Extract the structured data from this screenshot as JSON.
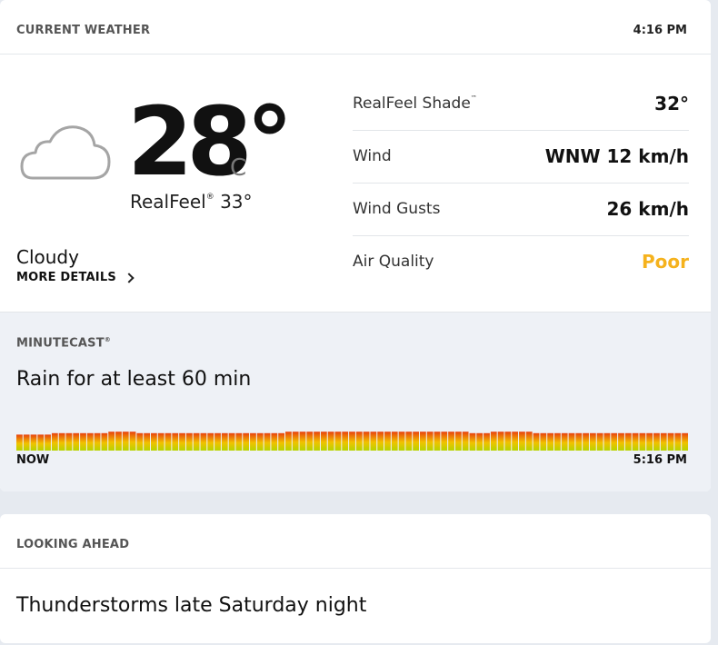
{
  "current_weather": {
    "title": "CURRENT WEATHER",
    "time": "4:16 PM",
    "icon": "cloud-icon",
    "temperature": "28°",
    "unit": "C",
    "realfeel_label": "RealFeel",
    "realfeel_value": "33°",
    "condition": "Cloudy",
    "more_details": "MORE DETAILS",
    "details": [
      {
        "label": "RealFeel Shade",
        "mark": "™",
        "value": "32°",
        "color": "#111111"
      },
      {
        "label": "Wind",
        "mark": "",
        "value": "WNW 12 km/h",
        "color": "#111111"
      },
      {
        "label": "Wind Gusts",
        "mark": "",
        "value": "26 km/h",
        "color": "#111111"
      },
      {
        "label": "Air Quality",
        "mark": "",
        "value": "Poor",
        "color": "#f5b21d"
      }
    ]
  },
  "minutecast": {
    "title": "MINUTECAST",
    "summary": "Rain for at least 60 min",
    "start_label": "NOW",
    "end_label": "5:16 PM",
    "intensities": [
      1,
      1,
      1,
      1,
      1,
      2,
      2,
      2,
      2,
      2,
      2,
      2,
      2,
      3,
      3,
      3,
      3,
      2,
      2,
      2,
      2,
      2,
      2,
      2,
      2,
      2,
      2,
      2,
      2,
      2,
      2,
      2,
      2,
      2,
      2,
      2,
      2,
      2,
      3,
      3,
      3,
      3,
      3,
      3,
      3,
      3,
      3,
      3,
      3,
      3,
      3,
      3,
      3,
      3,
      3,
      3,
      3,
      3,
      3,
      3,
      3,
      3,
      3,
      3,
      2,
      2,
      2,
      3,
      3,
      3,
      3,
      3,
      3,
      2,
      2,
      2,
      2,
      2,
      2,
      2,
      2,
      2,
      2,
      2,
      2,
      2,
      2,
      2,
      2,
      2,
      2,
      2,
      2,
      2,
      2
    ],
    "colors": {
      "low": "#b6d400",
      "mid": "#f2c200",
      "high": "#e8420e"
    }
  },
  "looking_ahead": {
    "title": "LOOKING AHEAD",
    "text": "Thunderstorms late Saturday night"
  }
}
